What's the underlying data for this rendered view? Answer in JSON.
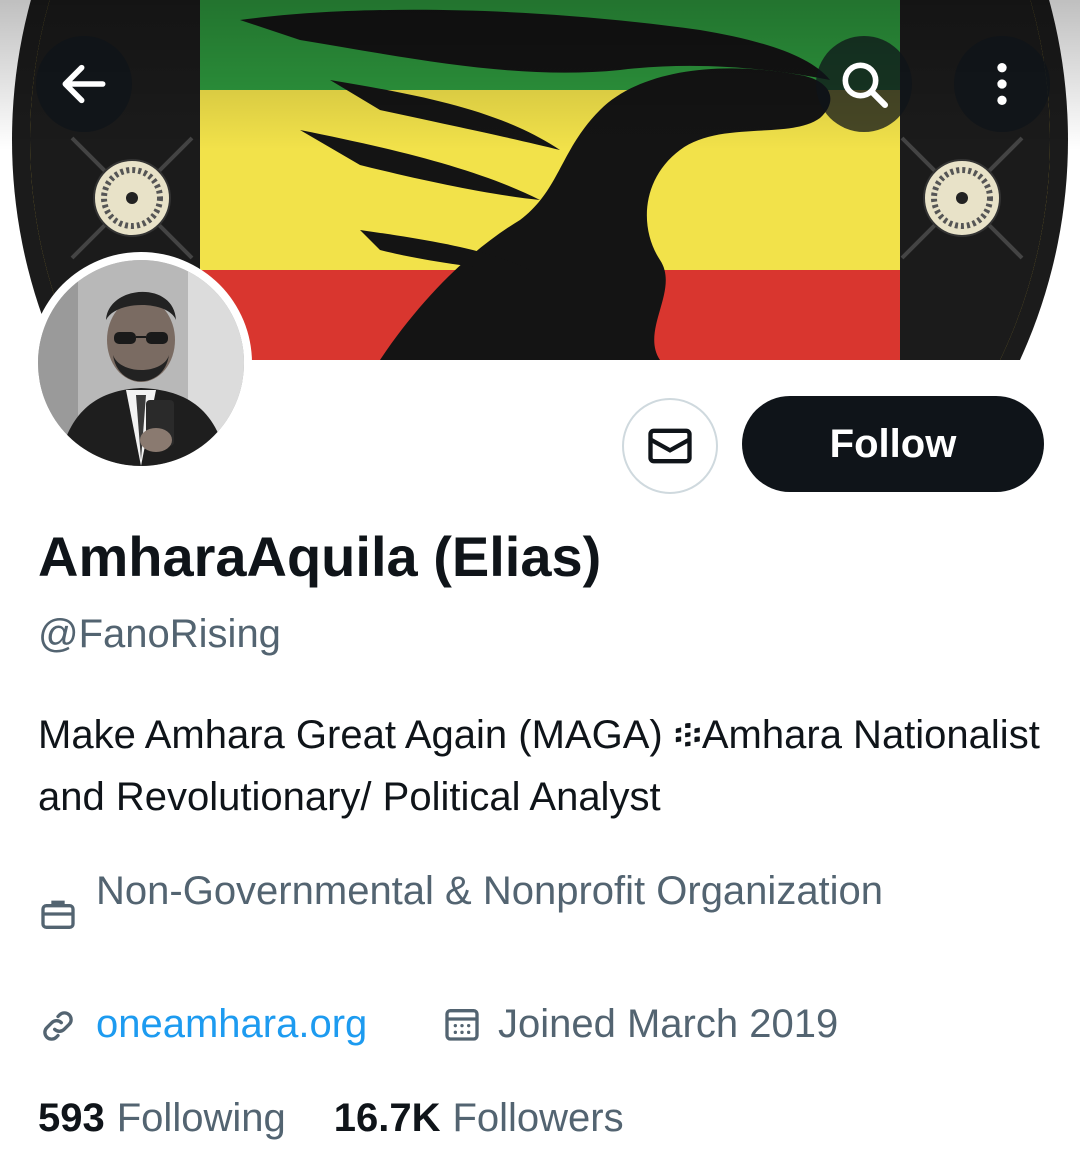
{
  "header": {
    "back_icon": "arrow-left-icon",
    "search_icon": "search-icon",
    "more_icon": "more-vertical-icon"
  },
  "banner": {
    "description": "",
    "colors": {
      "green": "#2e9a3e",
      "yellow": "#f2e24a",
      "red": "#d9362f",
      "black": "#111111"
    }
  },
  "profile": {
    "display_name": "AmharaAquila (Elias)",
    "handle": "@FanoRising",
    "bio": "Make Amhara Great Again (MAGA) ፨Amhara Nationalist and Revolutionary/ Political Analyst",
    "category": "Non-Governmental & Nonprofit Organization",
    "website": "oneamhara.org",
    "joined": "Joined March 2019"
  },
  "actions": {
    "message_icon": "envelope-icon",
    "follow_label": "Follow"
  },
  "stats": {
    "following_count": "593",
    "following_label": "Following",
    "followers_count": "16.7K",
    "followers_label": "Followers"
  },
  "colors": {
    "text_primary": "#0f1419",
    "text_secondary": "#536471",
    "link": "#1d9bf0",
    "button_dark": "#0f1419",
    "border": "#cfd9de"
  }
}
